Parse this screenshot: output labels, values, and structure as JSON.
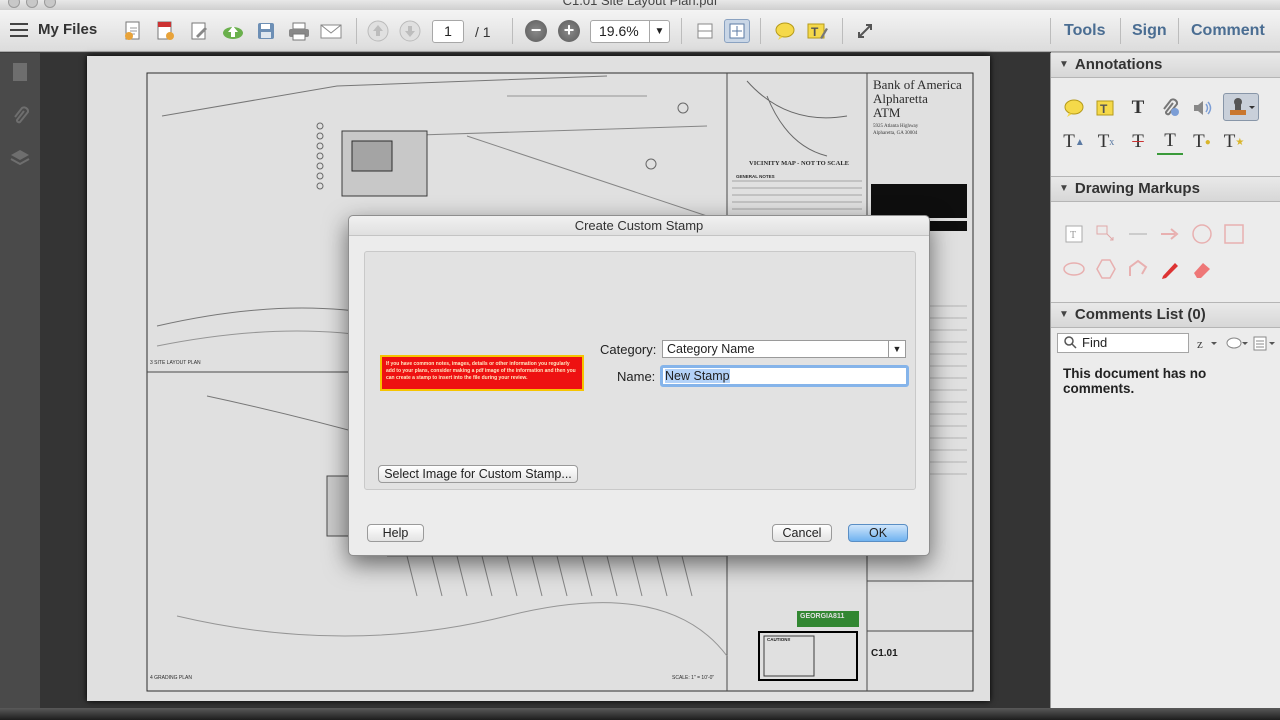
{
  "window": {
    "title": "C1.01 Site Layout Plan.pdf"
  },
  "toolbar": {
    "my_files_label": "My Files",
    "page_current": "1",
    "page_total": "/ 1",
    "zoom_value": "19.6%",
    "tools_label": "Tools",
    "sign_label": "Sign",
    "comment_label": "Comment"
  },
  "right_panel": {
    "annotations_title": "Annotations",
    "drawing_markups_title": "Drawing Markups",
    "comments_list_title": "Comments List (0)",
    "find_placeholder": "Find",
    "no_comments_text": "This document has no comments."
  },
  "dialog": {
    "title": "Create Custom Stamp",
    "category_label": "Category:",
    "category_value": "Category Name",
    "name_label": "Name:",
    "name_value": "New Stamp",
    "select_image_button": "Select Image for Custom Stamp...",
    "help_button": "Help",
    "cancel_button": "Cancel",
    "ok_button": "OK",
    "stamp_preview_text": "If you have common notes, images, details or other information you regularly add to your plans, consider making a pdf image of the information and then you can create a stamp to insert into the file during your review."
  },
  "document": {
    "title_block_line1": "Bank of America",
    "title_block_line2": "Alpharetta",
    "title_block_line3": "ATM",
    "title_block_address1": "5925 Atlanta Highway",
    "title_block_address2": "Alpharetta, GA 30004",
    "vicinity_map_label": "VICINITY MAP - NOT TO SCALE",
    "general_notes_label": "GENERAL NOTES",
    "site_layout_label": "3   SITE LAYOUT PLAN",
    "grading_label": "4   GRADING PLAN",
    "scale_label": "SCALE: 1\" = 10'-0\"",
    "sheet_number": "C1.01",
    "georgia811_label": "GEORGIA811",
    "caution_label": "CAUTION!!"
  },
  "colors": {
    "accent_link": "#4a6d92",
    "stamp_red": "#ee1111",
    "stamp_border": "#f6c400",
    "ok_blue": "#6fb2f0"
  },
  "icons": [
    "menu-icon",
    "create-pdf-icon",
    "export-pdf-icon",
    "edit-pdf-icon",
    "upload-cloud-icon",
    "save-icon",
    "print-icon",
    "email-icon",
    "page-up-icon",
    "page-down-icon",
    "zoom-out-icon",
    "zoom-in-icon",
    "fit-width-icon",
    "fit-page-icon",
    "sticky-note-icon",
    "highlight-icon",
    "full-screen-icon",
    "pages-panel-icon",
    "attachments-icon",
    "layers-icon"
  ]
}
